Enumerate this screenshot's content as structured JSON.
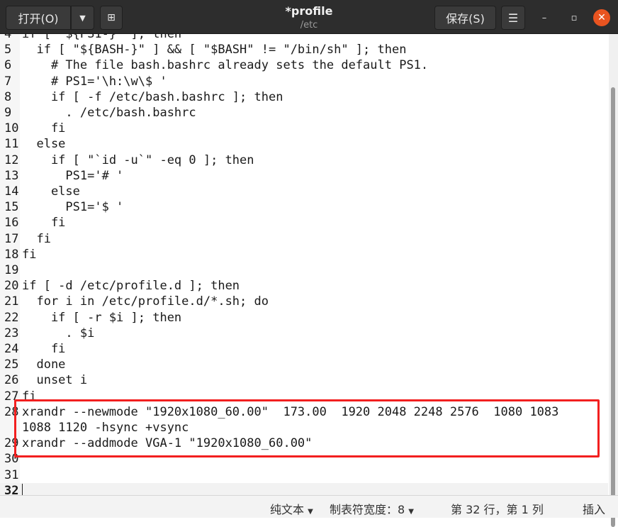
{
  "header": {
    "open_label": "打开(O)",
    "open_menu_icon": "chevron-down-icon",
    "new_tab_icon": "new-document-icon",
    "title": "*profile",
    "subtitle": "/etc",
    "save_label": "保存(S)",
    "menu_icon": "hamburger-icon",
    "minimize": "–",
    "maximize": "▫",
    "close": "✕"
  },
  "editor": {
    "current_line": 32,
    "lines": [
      {
        "num": "4",
        "text": "if [ \"${PS1-}\" ]; then"
      },
      {
        "num": "5",
        "text": "  if [ \"${BASH-}\" ] && [ \"$BASH\" != \"/bin/sh\" ]; then"
      },
      {
        "num": "6",
        "text": "    # The file bash.bashrc already sets the default PS1."
      },
      {
        "num": "7",
        "text": "    # PS1='\\h:\\w\\$ '"
      },
      {
        "num": "8",
        "text": "    if [ -f /etc/bash.bashrc ]; then"
      },
      {
        "num": "9",
        "text": "      . /etc/bash.bashrc"
      },
      {
        "num": "10",
        "text": "    fi"
      },
      {
        "num": "11",
        "text": "  else"
      },
      {
        "num": "12",
        "text": "    if [ \"`id -u`\" -eq 0 ]; then"
      },
      {
        "num": "13",
        "text": "      PS1='# '"
      },
      {
        "num": "14",
        "text": "    else"
      },
      {
        "num": "15",
        "text": "      PS1='$ '"
      },
      {
        "num": "16",
        "text": "    fi"
      },
      {
        "num": "17",
        "text": "  fi"
      },
      {
        "num": "18",
        "text": "fi"
      },
      {
        "num": "19",
        "text": ""
      },
      {
        "num": "20",
        "text": "if [ -d /etc/profile.d ]; then"
      },
      {
        "num": "21",
        "text": "  for i in /etc/profile.d/*.sh; do"
      },
      {
        "num": "22",
        "text": "    if [ -r $i ]; then"
      },
      {
        "num": "23",
        "text": "      . $i"
      },
      {
        "num": "24",
        "text": "    fi"
      },
      {
        "num": "25",
        "text": "  done"
      },
      {
        "num": "26",
        "text": "  unset i"
      },
      {
        "num": "27",
        "text": "fi"
      },
      {
        "num": "28",
        "text": "xrandr --newmode \"1920x1080_60.00\"  173.00  1920 2048 2248 2576  1080 1083"
      },
      {
        "num": "",
        "text": "1088 1120 -hsync +vsync"
      },
      {
        "num": "29",
        "text": "xrandr --addmode VGA-1 \"1920x1080_60.00\""
      },
      {
        "num": "30",
        "text": ""
      },
      {
        "num": "31",
        "text": ""
      },
      {
        "num": "32",
        "text": ""
      }
    ],
    "highlight_color": "#f21f1f"
  },
  "status": {
    "language": "纯文本",
    "tab_width": "制表符宽度：8",
    "position": "第 32 行，第 1 列",
    "mode": "插入"
  }
}
